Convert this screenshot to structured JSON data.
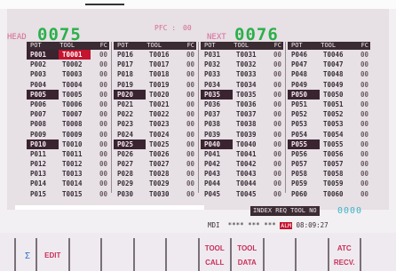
{
  "header": {
    "head_label": "HEAD",
    "head_value": "0075",
    "pfc_label": "PFC :",
    "pfc_value": "00",
    "next_label": "NEXT",
    "next_value": "0076"
  },
  "columns_header": {
    "pot": "POT",
    "tool": "TOOL",
    "fc": "FC"
  },
  "tables": [
    {
      "rows": [
        {
          "pot": "P001",
          "tool": "T0001",
          "fc": "00",
          "pot_hl": true,
          "tool_hl": "red"
        },
        {
          "pot": "P002",
          "tool": "T0002",
          "fc": "00"
        },
        {
          "pot": "P003",
          "tool": "T0003",
          "fc": "00"
        },
        {
          "pot": "P004",
          "tool": "T0004",
          "fc": "00"
        },
        {
          "pot": "P005",
          "tool": "T0005",
          "fc": "00",
          "pot_hl": true
        },
        {
          "pot": "P006",
          "tool": "T0006",
          "fc": "00"
        },
        {
          "pot": "P007",
          "tool": "T0007",
          "fc": "00"
        },
        {
          "pot": "P008",
          "tool": "T0008",
          "fc": "00"
        },
        {
          "pot": "P009",
          "tool": "T0009",
          "fc": "00"
        },
        {
          "pot": "P010",
          "tool": "T0010",
          "fc": "00",
          "pot_hl": true
        },
        {
          "pot": "P011",
          "tool": "T0011",
          "fc": "00"
        },
        {
          "pot": "P012",
          "tool": "T0012",
          "fc": "00"
        },
        {
          "pot": "P013",
          "tool": "T0013",
          "fc": "00"
        },
        {
          "pot": "P014",
          "tool": "T0014",
          "fc": "00"
        },
        {
          "pot": "P015",
          "tool": "T0015",
          "fc": "00"
        }
      ]
    },
    {
      "rows": [
        {
          "pot": "P016",
          "tool": "T0016",
          "fc": "00"
        },
        {
          "pot": "P017",
          "tool": "T0017",
          "fc": "00"
        },
        {
          "pot": "P018",
          "tool": "T0018",
          "fc": "00"
        },
        {
          "pot": "P019",
          "tool": "T0019",
          "fc": "00"
        },
        {
          "pot": "P020",
          "tool": "T0020",
          "fc": "00",
          "pot_hl": true
        },
        {
          "pot": "P021",
          "tool": "T0021",
          "fc": "00"
        },
        {
          "pot": "P022",
          "tool": "T0022",
          "fc": "00"
        },
        {
          "pot": "P023",
          "tool": "T0023",
          "fc": "00"
        },
        {
          "pot": "P024",
          "tool": "T0024",
          "fc": "00"
        },
        {
          "pot": "P025",
          "tool": "T0025",
          "fc": "00",
          "pot_hl": true
        },
        {
          "pot": "P026",
          "tool": "T0026",
          "fc": "00"
        },
        {
          "pot": "P027",
          "tool": "T0027",
          "fc": "00"
        },
        {
          "pot": "P028",
          "tool": "T0028",
          "fc": "00"
        },
        {
          "pot": "P029",
          "tool": "T0029",
          "fc": "00"
        },
        {
          "pot": "P030",
          "tool": "T0030",
          "fc": "00"
        }
      ]
    },
    {
      "rows": [
        {
          "pot": "P031",
          "tool": "T0031",
          "fc": "00"
        },
        {
          "pot": "P032",
          "tool": "T0032",
          "fc": "00"
        },
        {
          "pot": "P033",
          "tool": "T0033",
          "fc": "00"
        },
        {
          "pot": "P034",
          "tool": "T0034",
          "fc": "00"
        },
        {
          "pot": "P035",
          "tool": "T0035",
          "fc": "00",
          "pot_hl": true
        },
        {
          "pot": "P036",
          "tool": "T0036",
          "fc": "00"
        },
        {
          "pot": "P037",
          "tool": "T0037",
          "fc": "00"
        },
        {
          "pot": "P038",
          "tool": "T0038",
          "fc": "00"
        },
        {
          "pot": "P039",
          "tool": "T0039",
          "fc": "00"
        },
        {
          "pot": "P040",
          "tool": "T0040",
          "fc": "00",
          "pot_hl": true
        },
        {
          "pot": "P041",
          "tool": "T0041",
          "fc": "00"
        },
        {
          "pot": "P042",
          "tool": "T0042",
          "fc": "00"
        },
        {
          "pot": "P043",
          "tool": "T0043",
          "fc": "00"
        },
        {
          "pot": "P044",
          "tool": "T0044",
          "fc": "00"
        },
        {
          "pot": "P045",
          "tool": "T0045",
          "fc": "00"
        }
      ]
    },
    {
      "rows": [
        {
          "pot": "P046",
          "tool": "T0046",
          "fc": "00"
        },
        {
          "pot": "P047",
          "tool": "T0047",
          "fc": "00"
        },
        {
          "pot": "P048",
          "tool": "T0048",
          "fc": "00"
        },
        {
          "pot": "P049",
          "tool": "T0049",
          "fc": "00"
        },
        {
          "pot": "P050",
          "tool": "T0050",
          "fc": "00",
          "pot_hl": true
        },
        {
          "pot": "P051",
          "tool": "T0051",
          "fc": "00"
        },
        {
          "pot": "P052",
          "tool": "T0052",
          "fc": "00"
        },
        {
          "pot": "P053",
          "tool": "T0053",
          "fc": "00"
        },
        {
          "pot": "P054",
          "tool": "T0054",
          "fc": "00"
        },
        {
          "pot": "P055",
          "tool": "T0055",
          "fc": "00",
          "pot_hl": true
        },
        {
          "pot": "P056",
          "tool": "T0056",
          "fc": "00"
        },
        {
          "pot": "P057",
          "tool": "T0057",
          "fc": "00"
        },
        {
          "pot": "P058",
          "tool": "T0058",
          "fc": "00"
        },
        {
          "pot": "P059",
          "tool": "T0059",
          "fc": "00"
        },
        {
          "pot": "P060",
          "tool": "T0060",
          "fc": "00"
        }
      ]
    }
  ],
  "index_req_label": "INDEX REQ TOOL NO",
  "index_req_value": "0000",
  "status": {
    "mode": "MDI",
    "fields": "**** *** ***",
    "alarm": "ALM",
    "time": "08:09:27"
  },
  "softkeys": [
    {
      "line1": "EDIT",
      "line2": ""
    },
    {
      "line1": "",
      "line2": ""
    },
    {
      "line1": "",
      "line2": ""
    },
    {
      "line1": "",
      "line2": ""
    },
    {
      "line1": "",
      "line2": ""
    },
    {
      "line1": "TOOL",
      "line2": "CALL"
    },
    {
      "line1": "TOOL",
      "line2": "DATA"
    },
    {
      "line1": "",
      "line2": ""
    },
    {
      "line1": "",
      "line2": ""
    },
    {
      "line1": "ATC",
      "line2": "RECV."
    },
    {
      "line1": "",
      "line2": ""
    }
  ],
  "softkey_icon": "sigma-icon"
}
